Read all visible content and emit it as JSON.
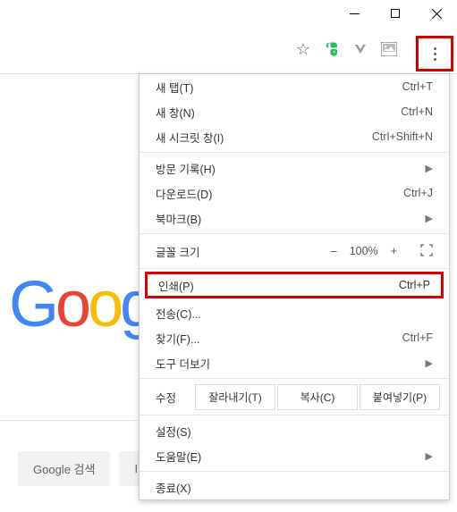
{
  "window": {
    "min": "–",
    "max": "☐",
    "close": "✕"
  },
  "toolbar": {
    "star": "☆"
  },
  "menu": {
    "new_tab": {
      "label": "새 탭(T)",
      "shortcut": "Ctrl+T"
    },
    "new_window": {
      "label": "새 창(N)",
      "shortcut": "Ctrl+N"
    },
    "incognito": {
      "label": "새 시크릿 창(I)",
      "shortcut": "Ctrl+Shift+N"
    },
    "history": {
      "label": "방문 기록(H)"
    },
    "downloads": {
      "label": "다운로드(D)",
      "shortcut": "Ctrl+J"
    },
    "bookmarks": {
      "label": "북마크(B)"
    },
    "zoom": {
      "label": "글꼴 크기",
      "minus": "–",
      "value": "100%",
      "plus": "+"
    },
    "print": {
      "label": "인쇄(P)",
      "shortcut": "Ctrl+P"
    },
    "cast": {
      "label": "전송(C)..."
    },
    "find": {
      "label": "찾기(F)...",
      "shortcut": "Ctrl+F"
    },
    "more_tools": {
      "label": "도구 더보기"
    },
    "edit": {
      "label": "수정",
      "cut": "잘라내기(T)",
      "copy": "복사(C)",
      "paste": "붙여넣기(P)"
    },
    "settings": {
      "label": "설정(S)"
    },
    "help": {
      "label": "도움말(E)"
    },
    "exit": {
      "label": "종료(X)"
    }
  },
  "google": {
    "search_btn": "Google 검색",
    "lucky_btn": "I'm Feeling Lucky"
  }
}
